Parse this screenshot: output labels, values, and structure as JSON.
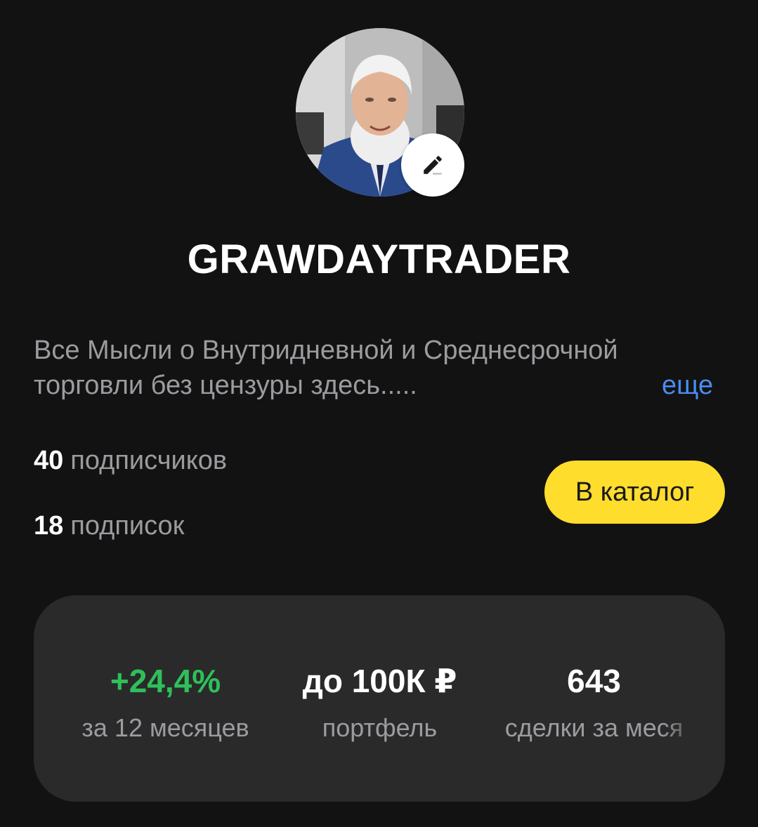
{
  "profile": {
    "username": "GRAWDAYTRADER",
    "description": "Все Мысли о Внутридневной и Среднесрочной торговли без цензуры здесь.....",
    "more_label": "еще",
    "avatar_icon": "user-avatar-photo",
    "edit_icon": "pencil-icon"
  },
  "counts": {
    "followers_number": "40",
    "followers_label": "подписчиков",
    "following_number": "18",
    "following_label": "подписок"
  },
  "catalog_button": {
    "label": "В каталог",
    "color": "#ffdd2d"
  },
  "stats": [
    {
      "value": "+24,4%",
      "label": "за 12 месяцев",
      "color": "#2ec05a"
    },
    {
      "value": "до 100К ₽",
      "label": "портфель"
    },
    {
      "value": "643",
      "label": "сделки за меся"
    }
  ],
  "colors": {
    "background": "#121212",
    "card": "#2a2a2a",
    "secondary_text": "#9b9ba0",
    "link": "#4a8cf0"
  }
}
